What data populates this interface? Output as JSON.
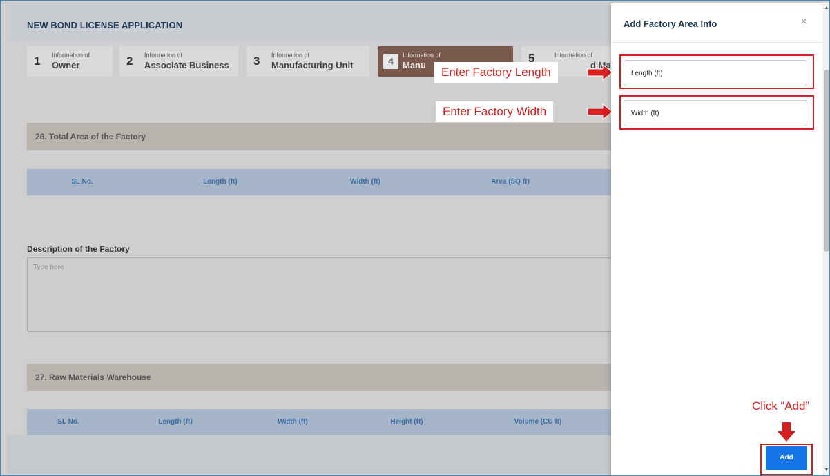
{
  "page": {
    "title": "NEW BOND LICENSE APPLICATION",
    "steps": [
      {
        "num": "1",
        "small": "Information of",
        "big": "Owner"
      },
      {
        "num": "2",
        "small": "Information of",
        "big": "Associate Business"
      },
      {
        "num": "3",
        "small": "Information of",
        "big": "Manufacturing Unit"
      },
      {
        "num": "4",
        "small": "Information of",
        "big": "Manu"
      },
      {
        "num": "5",
        "small": "Information of",
        "big": "d Mat"
      }
    ],
    "section26": "26. Total Area of the Factory",
    "table1_headers": [
      "SL No.",
      "Length (ft)",
      "Width (ft)",
      "Area (SQ ft)"
    ],
    "description_label": "Description of the Factory",
    "description_placeholder": "Type here",
    "section27": "27. Raw Materials Warehouse",
    "table2_headers": [
      "SL No.",
      "Length (ft)",
      "Width (ft)",
      "Height (ft)",
      "Volume (CU ft)"
    ]
  },
  "drawer": {
    "title": "Add Factory Area Info",
    "close": "×",
    "length_placeholder": "Length (ft)",
    "width_placeholder": "Width (ft)",
    "add_label": "Add"
  },
  "annotations": {
    "length": "Enter Factory Length",
    "width": "Enter Factory Width",
    "click_add": "Click “Add”"
  },
  "colors": {
    "accent": "#1473e6",
    "annotation": "#d62020",
    "active_step": "#7b5a4e"
  }
}
